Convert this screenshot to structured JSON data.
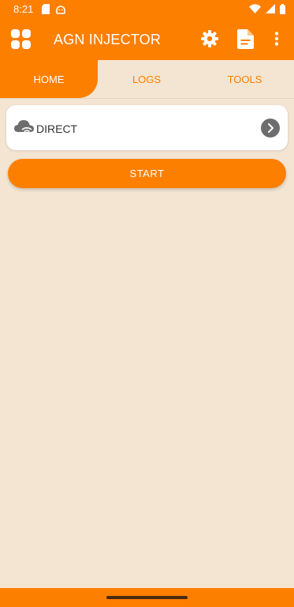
{
  "status_bar": {
    "time": "8:21",
    "icons_left": [
      "sd-card-icon",
      "android-robot-icon"
    ],
    "icons_right": [
      "wifi-icon",
      "cellular-signal-icon",
      "battery-icon"
    ]
  },
  "app_bar": {
    "title": "AGN INJECTOR",
    "icons": [
      "apps-grid-icon",
      "settings-gear-icon",
      "document-icon",
      "more-vert-icon"
    ]
  },
  "tabs": [
    {
      "label": "HOME",
      "active": true
    },
    {
      "label": "LOGS",
      "active": false
    },
    {
      "label": "TOOLS",
      "active": false
    }
  ],
  "mode_card": {
    "label": "DIRECT",
    "icon": "cloud-wifi-icon",
    "action_icon": "chevron-right-icon"
  },
  "start_button": {
    "label": "START"
  },
  "colors": {
    "primary": "#fd7f00",
    "background": "#f3e5d2",
    "card": "#ffffff",
    "icon_gray": "#6d6d6d"
  }
}
